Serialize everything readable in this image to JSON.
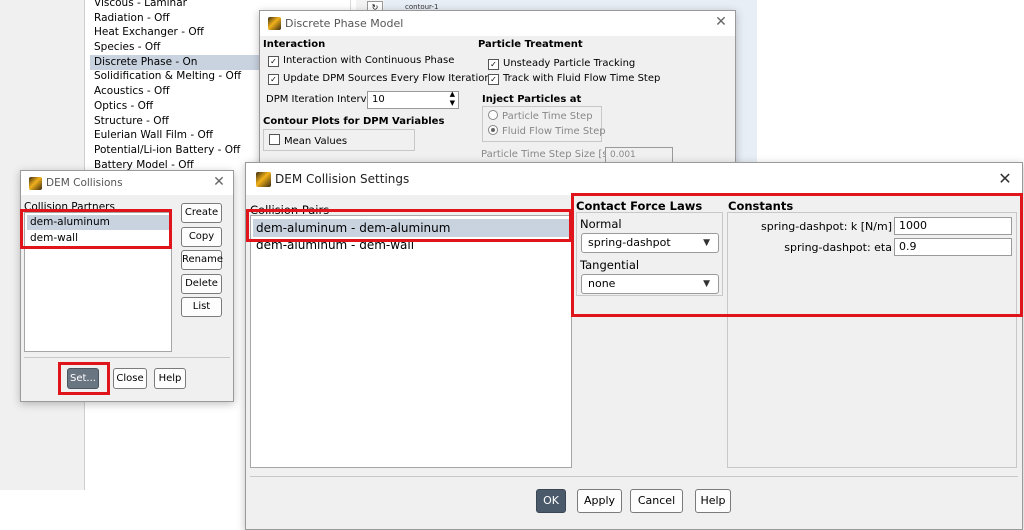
{
  "tree": {
    "items": [
      "Viscous - Laminar",
      "Radiation - Off",
      "Heat Exchanger - Off",
      "Species - Off",
      "Discrete Phase - On",
      "Solidification & Melting - Off",
      "Acoustics - Off",
      "Optics - Off",
      "Structure - Off",
      "Eulerian Wall Film - Off",
      "Potential/Li-ion Battery - Off",
      "Battery Model - Off"
    ],
    "selected_index": 4
  },
  "viewport": {
    "text": "contour-1"
  },
  "dpm": {
    "title": "Discrete Phase Model",
    "interaction_heading": "Interaction",
    "interaction_continuous": "Interaction with Continuous Phase",
    "update_sources": "Update DPM Sources Every Flow Iteration",
    "iteration_interval_label": "DPM Iteration Interval",
    "iteration_interval_value": "10",
    "contour_heading": "Contour Plots for DPM Variables",
    "mean_values": "Mean Values",
    "particle_treatment_heading": "Particle Treatment",
    "unsteady_tracking": "Unsteady Particle Tracking",
    "track_with_flow": "Track with Fluid Flow Time Step",
    "inject_heading": "Inject Particles at",
    "particle_time_step": "Particle Time Step",
    "fluid_flow_time_step": "Fluid Flow Time Step",
    "particle_time_step_size_label": "Particle Time Step Size [s]",
    "particle_time_step_size_value": "0.001"
  },
  "dem": {
    "title": "DEM Collisions",
    "partners_label": "Collision Partners",
    "partners": [
      "dem-aluminum",
      "dem-wall"
    ],
    "buttons": {
      "create": "Create",
      "copy": "Copy",
      "rename": "Rename",
      "delete": "Delete",
      "list": "List"
    },
    "set": "Set...",
    "close": "Close",
    "help": "Help"
  },
  "settings": {
    "title": "DEM Collision Settings",
    "pairs_label": "Collision Pairs",
    "pairs": [
      "dem-aluminum - dem-aluminum",
      "dem-aluminum - dem-wall"
    ],
    "contact_heading": "Contact Force Laws",
    "normal_label": "Normal",
    "normal_value": "spring-dashpot",
    "tangential_label": "Tangential",
    "tangential_value": "none",
    "constants_heading": "Constants",
    "k_label": "spring-dashpot: k [N/m]",
    "k_value": "1000",
    "eta_label": "spring-dashpot: eta",
    "eta_value": "0.9",
    "ok": "OK",
    "apply": "Apply",
    "cancel": "Cancel",
    "help": "Help"
  },
  "colors": {
    "highlight": "#e0141b",
    "selection": "#c9d3e0",
    "ok_button": "#4a5a6a"
  }
}
